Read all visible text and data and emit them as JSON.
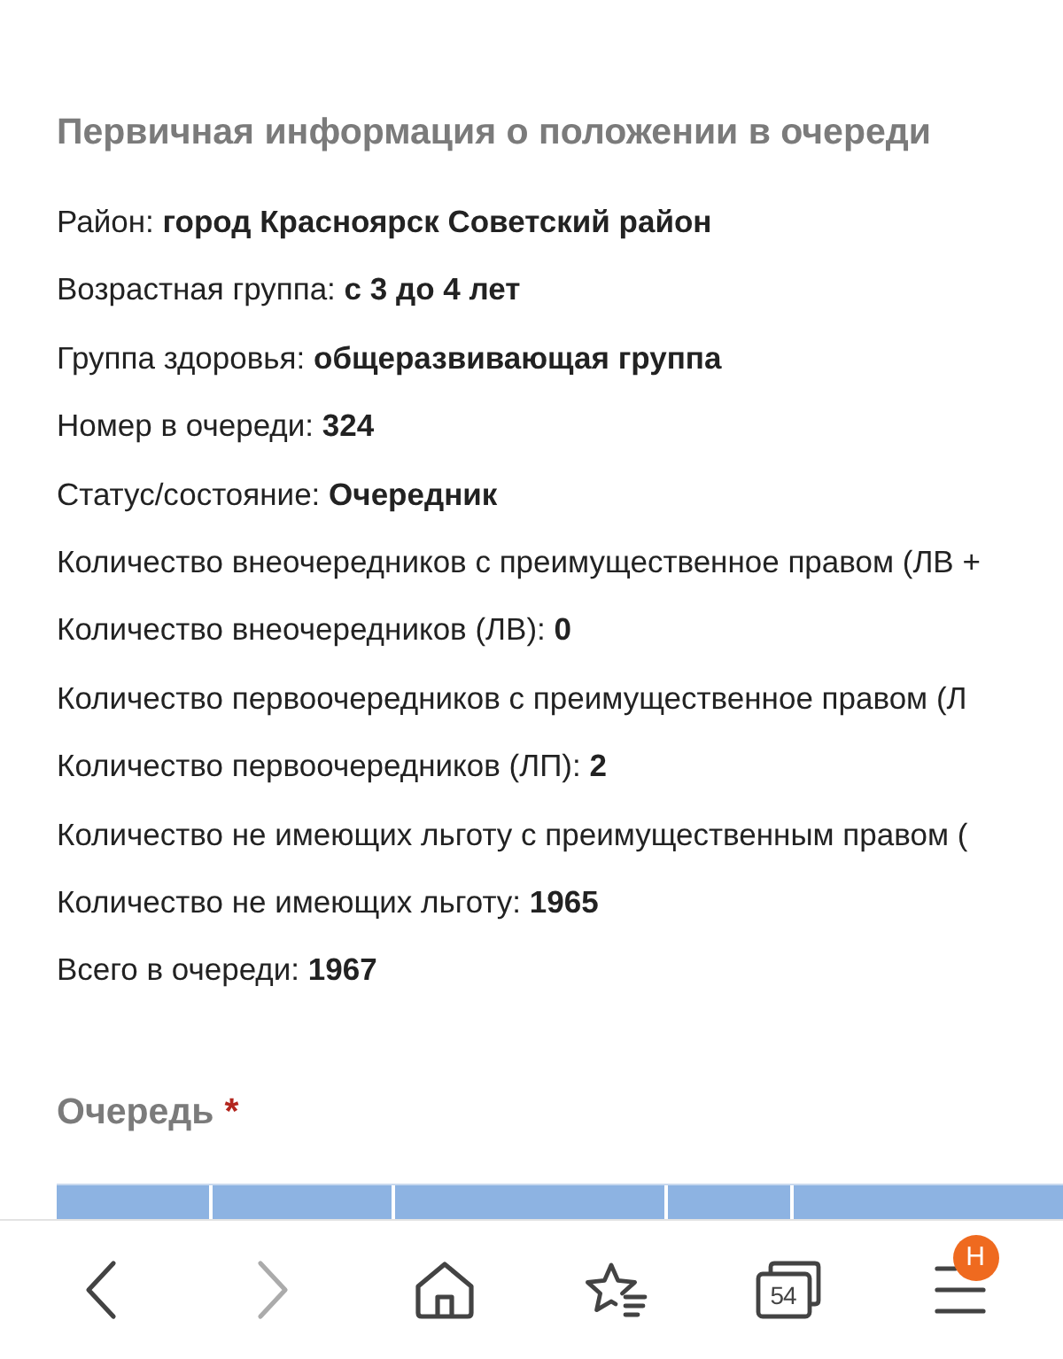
{
  "section": {
    "title": "Первичная информация о положении в очереди",
    "lines": [
      "Район: **город Красноярск Советский район**",
      "Возрастная группа: **с 3 до 4 лет**",
      "Группа здоровья: **общеразвивающая группа**",
      "Номер в очереди: **324**",
      "Статус/состояние: **Очередник**",
      "Количество внеочередников с преимущественное правом (ЛВ +",
      "Количество внеочередников (ЛВ): **0**",
      "Количество первоочередников с преимущественное правом (Л",
      "Количество первоочередников (ЛП): **2**",
      "Количество не имеющих льготу с преимущественным правом (",
      "Количество не имеющих льготу: **1965**",
      "Всего в очереди: **1967**"
    ]
  },
  "queue": {
    "title": "Очередь",
    "required_mark": "*"
  },
  "toolbar": {
    "buttons": [
      {
        "kind": "back",
        "disabled": false
      },
      {
        "kind": "forward",
        "disabled": true
      },
      {
        "kind": "home",
        "disabled": false
      },
      {
        "kind": "bookmarks",
        "disabled": false
      },
      {
        "kind": "tabs",
        "disabled": false,
        "count": "54"
      },
      {
        "kind": "menu",
        "disabled": false,
        "badge": "Н"
      }
    ]
  }
}
